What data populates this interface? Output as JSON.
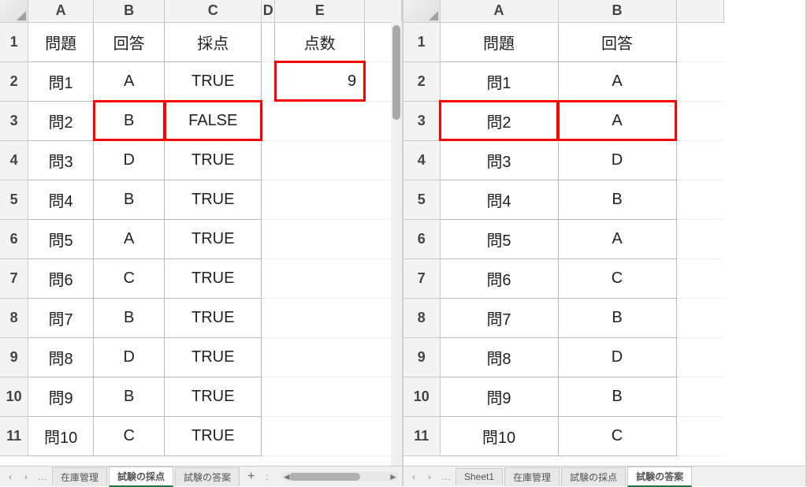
{
  "left": {
    "columns": [
      "A",
      "B",
      "C",
      "D",
      "E"
    ],
    "rowNumbers": [
      "1",
      "2",
      "3",
      "4",
      "5",
      "6",
      "7",
      "8",
      "9",
      "10",
      "11"
    ],
    "headers": {
      "A": "問題",
      "B": "回答",
      "C": "採点",
      "E": "点数"
    },
    "score": "9",
    "rows": [
      {
        "q": "問1",
        "a": "A",
        "r": "TRUE"
      },
      {
        "q": "問2",
        "a": "B",
        "r": "FALSE"
      },
      {
        "q": "問3",
        "a": "D",
        "r": "TRUE"
      },
      {
        "q": "問4",
        "a": "B",
        "r": "TRUE"
      },
      {
        "q": "問5",
        "a": "A",
        "r": "TRUE"
      },
      {
        "q": "問6",
        "a": "C",
        "r": "TRUE"
      },
      {
        "q": "問7",
        "a": "B",
        "r": "TRUE"
      },
      {
        "q": "問8",
        "a": "D",
        "r": "TRUE"
      },
      {
        "q": "問9",
        "a": "B",
        "r": "TRUE"
      },
      {
        "q": "問10",
        "a": "C",
        "r": "TRUE"
      }
    ],
    "tabs": [
      "在庫管理",
      "試験の採点",
      "試験の答案"
    ],
    "activeTab": "試験の採点"
  },
  "right": {
    "columns": [
      "A",
      "B"
    ],
    "rowNumbers": [
      "1",
      "2",
      "3",
      "4",
      "5",
      "6",
      "7",
      "8",
      "9",
      "10",
      "11"
    ],
    "headers": {
      "A": "問題",
      "B": "回答"
    },
    "rows": [
      {
        "q": "問1",
        "a": "A"
      },
      {
        "q": "問2",
        "a": "A"
      },
      {
        "q": "問3",
        "a": "D"
      },
      {
        "q": "問4",
        "a": "B"
      },
      {
        "q": "問5",
        "a": "A"
      },
      {
        "q": "問6",
        "a": "C"
      },
      {
        "q": "問7",
        "a": "B"
      },
      {
        "q": "問8",
        "a": "D"
      },
      {
        "q": "問9",
        "a": "B"
      },
      {
        "q": "問10",
        "a": "C"
      }
    ],
    "tabs": [
      "Sheet1",
      "在庫管理",
      "試験の採点",
      "試験の答案"
    ],
    "activeTab": "試験の答案"
  },
  "icons": {
    "prev": "‹",
    "next": "›",
    "dots": "…",
    "plus": "+",
    "menu": ":"
  },
  "chart_data": {
    "type": "table",
    "left_sheet": {
      "title": "試験の採点",
      "columns": [
        "問題",
        "回答",
        "採点",
        "点数"
      ],
      "rows": [
        [
          "問1",
          "A",
          "TRUE",
          9
        ],
        [
          "問2",
          "B",
          "FALSE",
          null
        ],
        [
          "問3",
          "D",
          "TRUE",
          null
        ],
        [
          "問4",
          "B",
          "TRUE",
          null
        ],
        [
          "問5",
          "A",
          "TRUE",
          null
        ],
        [
          "問6",
          "C",
          "TRUE",
          null
        ],
        [
          "問7",
          "B",
          "TRUE",
          null
        ],
        [
          "問8",
          "D",
          "TRUE",
          null
        ],
        [
          "問9",
          "B",
          "TRUE",
          null
        ],
        [
          "問10",
          "C",
          "TRUE",
          null
        ]
      ]
    },
    "right_sheet": {
      "title": "試験の答案",
      "columns": [
        "問題",
        "回答"
      ],
      "rows": [
        [
          "問1",
          "A"
        ],
        [
          "問2",
          "A"
        ],
        [
          "問3",
          "D"
        ],
        [
          "問4",
          "B"
        ],
        [
          "問5",
          "A"
        ],
        [
          "問6",
          "C"
        ],
        [
          "問7",
          "B"
        ],
        [
          "問8",
          "D"
        ],
        [
          "問9",
          "B"
        ],
        [
          "問10",
          "C"
        ]
      ]
    }
  }
}
